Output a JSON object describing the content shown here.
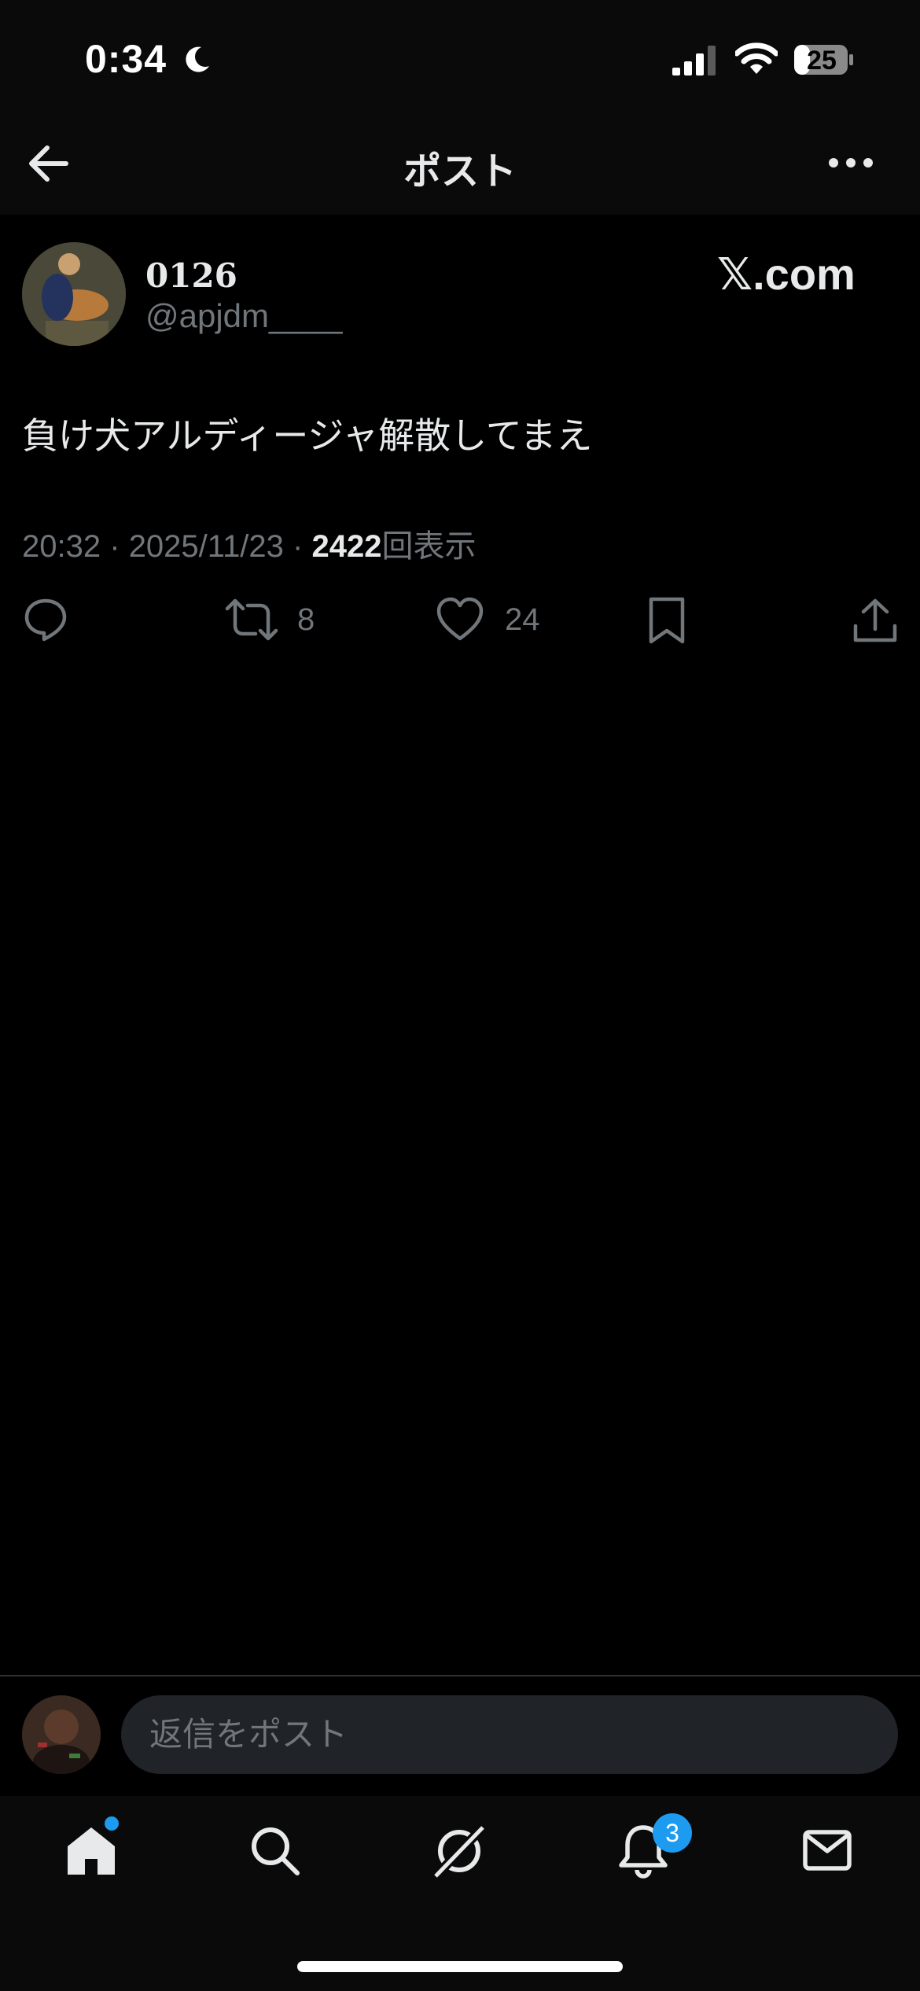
{
  "status_bar": {
    "time": "0:34",
    "battery": "25",
    "icons": [
      "moon-icon",
      "signal-icon",
      "wifi-icon",
      "battery-icon"
    ]
  },
  "header": {
    "title": "ポスト",
    "back_icon": "arrow-left-icon",
    "more_icon": "more-icon"
  },
  "post": {
    "display_name": "0126",
    "handle": "@apjdm____",
    "source_label": "𝕏.com",
    "text": "負け犬アルディージャ解散してまえ",
    "time": "20:32",
    "date": "2025/11/23",
    "views": "2422",
    "views_suffix": "回表示",
    "separator": "·"
  },
  "actions": {
    "reply_icon": "reply-icon",
    "retweet_icon": "retweet-icon",
    "retweet_count": "8",
    "like_icon": "heart-icon",
    "like_count": "24",
    "bookmark_icon": "bookmark-icon",
    "share_icon": "share-icon"
  },
  "reply": {
    "placeholder": "返信をポスト"
  },
  "tabbar": {
    "tabs": [
      "home-icon",
      "search-icon",
      "grok-icon",
      "bell-icon",
      "mail-icon"
    ],
    "notifications_badge": "3"
  },
  "colors": {
    "background": "#000000",
    "bar_background": "#0a0a0a",
    "primary_text": "#e7e9ea",
    "secondary_text": "#71767b",
    "accent": "#1d9bf0",
    "input_background": "#202327"
  }
}
